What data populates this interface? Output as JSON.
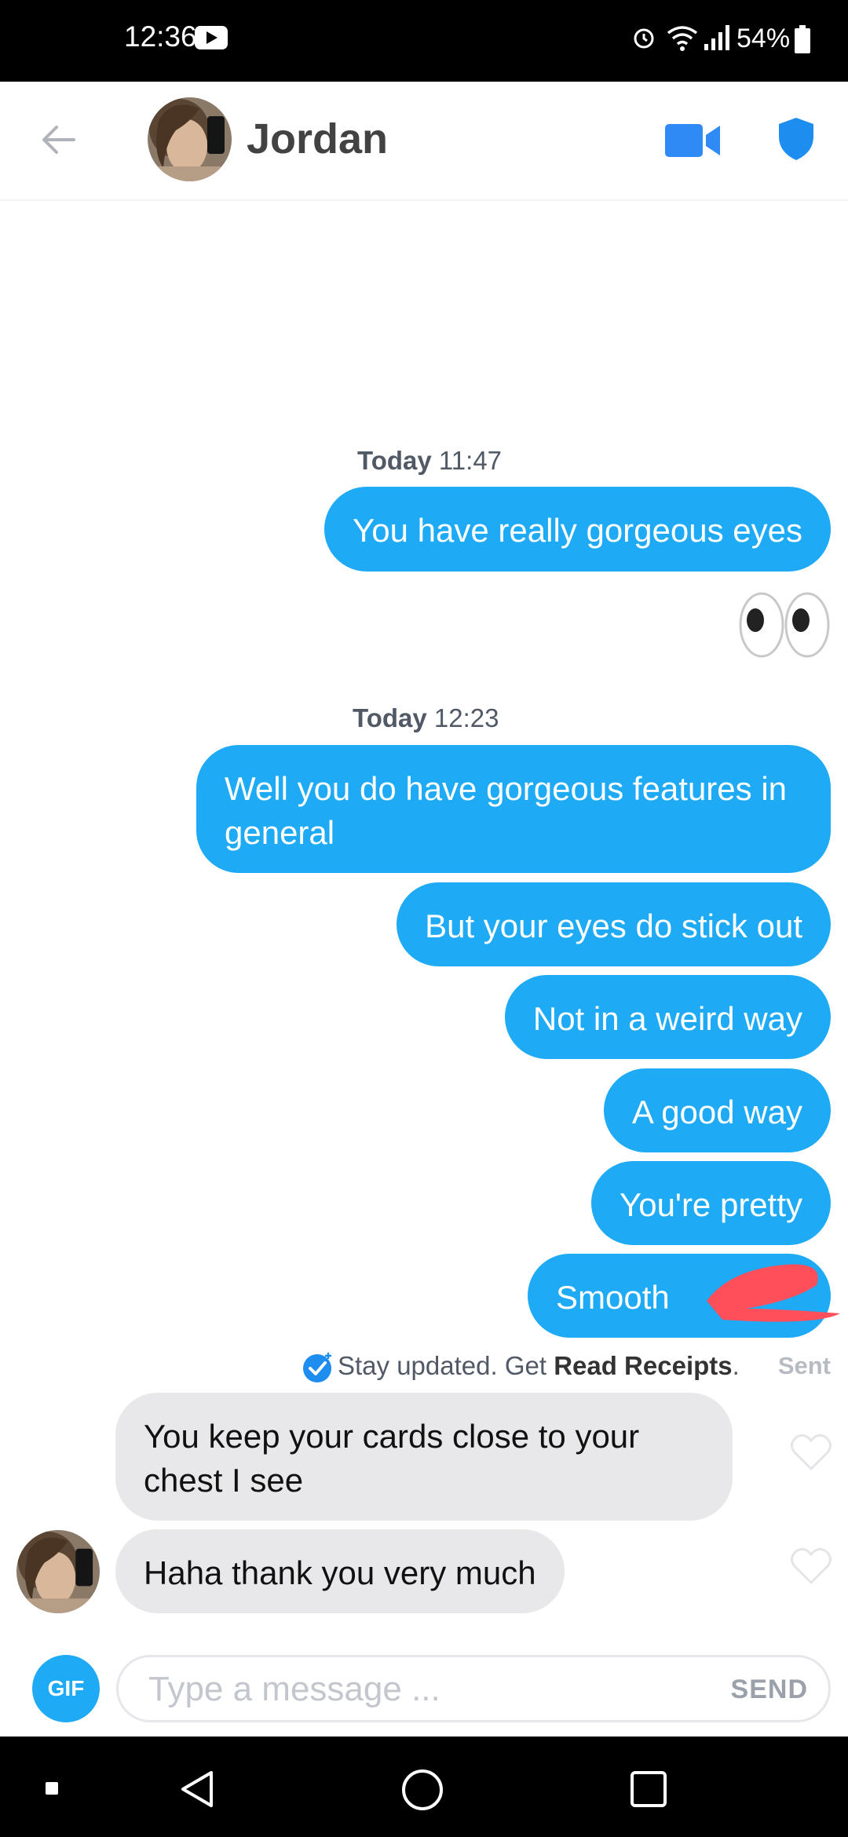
{
  "status_bar": {
    "time": "12:36",
    "battery": "54%"
  },
  "header": {
    "contact_name": "Jordan"
  },
  "messages": {
    "ts1": {
      "day": "Today",
      "time": "11:47"
    },
    "ts2": {
      "day": "Today",
      "time": "12:23"
    },
    "out1": "You have really gorgeous eyes",
    "out2": "Well you do have gorgeous features in general",
    "out3": "But your eyes do stick out",
    "out4": "Not in a weird way",
    "out5": "A good way",
    "out6": "You're pretty",
    "out7": "Smooth",
    "in1": "You keep your cards close to your chest I see",
    "in2": "Haha thank you very much"
  },
  "receipt": {
    "prefix": "Stay updated. Get",
    "link": "Read Receipts",
    "suffix": ".",
    "status": "Sent"
  },
  "composer": {
    "gif_label": "GIF",
    "placeholder": "Type a message ...",
    "send_label": "SEND"
  },
  "colors": {
    "accent": "#1eaaf5",
    "incoming_bubble": "#e8e8ea",
    "shield": "#1d8df0",
    "redaction": "#ff4f5a"
  }
}
